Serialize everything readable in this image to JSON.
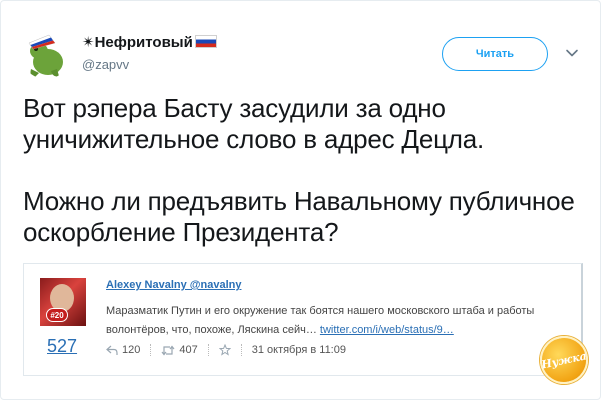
{
  "tweet": {
    "display_name": "✴Нефритовый",
    "handle": "@zapvv",
    "follow_label": "Читать",
    "paragraphs": [
      "Вот рэпера Басту засудили за одно уничижительное слово в адрес Децла.",
      "Можно ли предъявить Навальному публичное оскорбление Президента?"
    ]
  },
  "embedded": {
    "author": "Alexey Navalny @navalny",
    "avatar_badge": "#20",
    "count": "527",
    "text_line1": "Маразматик Путин и его окружение так боятся нашего московского штаба и работы",
    "text_line2": "волонтёров, что, похоже, Ляскина сейч…",
    "link": "twitter.com/i/web/status/9…",
    "replies": "120",
    "retweets": "407",
    "date": "31 октября в 11:09"
  },
  "watermark": "Нужка",
  "colors": {
    "accent": "#1da1f2",
    "link": "#2a6fb5",
    "text": "#14171a",
    "muted": "#657786"
  },
  "icons": [
    "frog-avatar",
    "russia-flag-icon",
    "chevron-down-icon",
    "reply-icon",
    "retweet-icon",
    "star-icon"
  ]
}
